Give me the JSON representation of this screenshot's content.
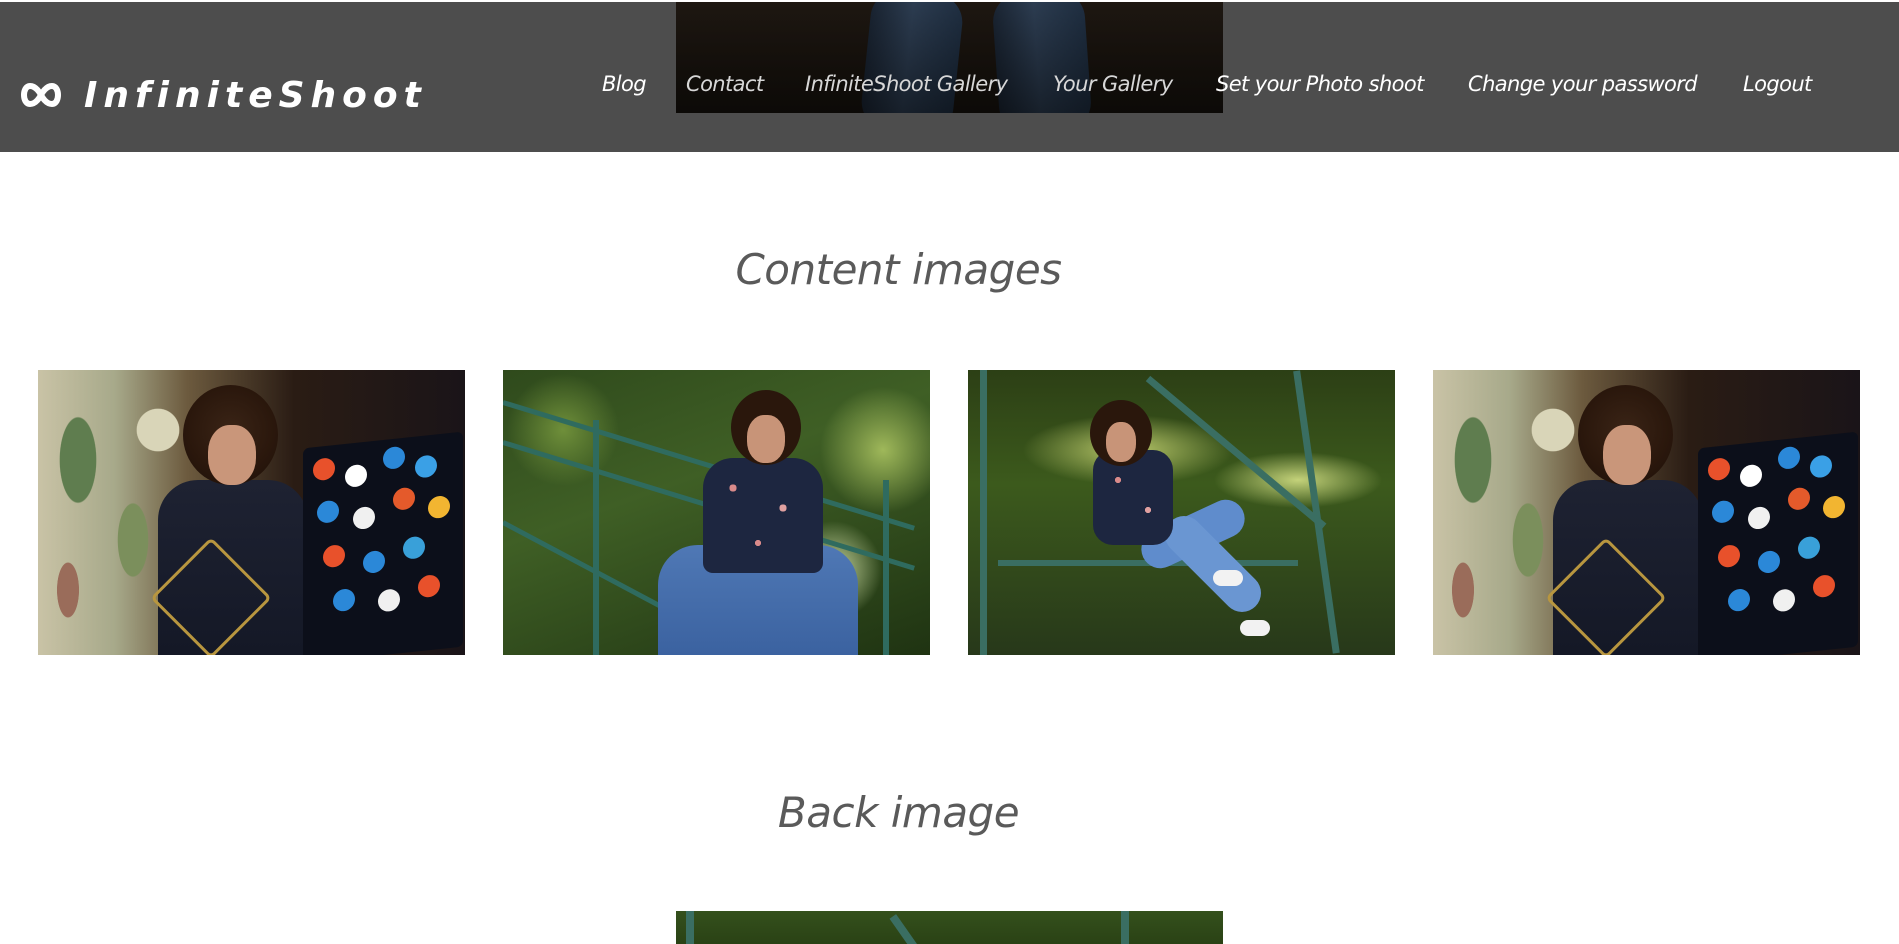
{
  "brand": {
    "name": "InfiniteShoot",
    "icon": "infinity-icon"
  },
  "nav": {
    "items": [
      {
        "label": "Blog"
      },
      {
        "label": "Contact"
      },
      {
        "label": "InfiniteShoot Gallery"
      },
      {
        "label": "Your Gallery"
      },
      {
        "label": "Set your Photo shoot"
      },
      {
        "label": "Change your password"
      },
      {
        "label": "Logout"
      }
    ]
  },
  "sections": {
    "content_images_title": "Content images",
    "back_image_title": "Back image"
  },
  "colors": {
    "header_bg": "#4d4d4d",
    "nav_text": "#ffffff",
    "section_title": "#5a5a5a",
    "page_bg": "#ffffff"
  }
}
